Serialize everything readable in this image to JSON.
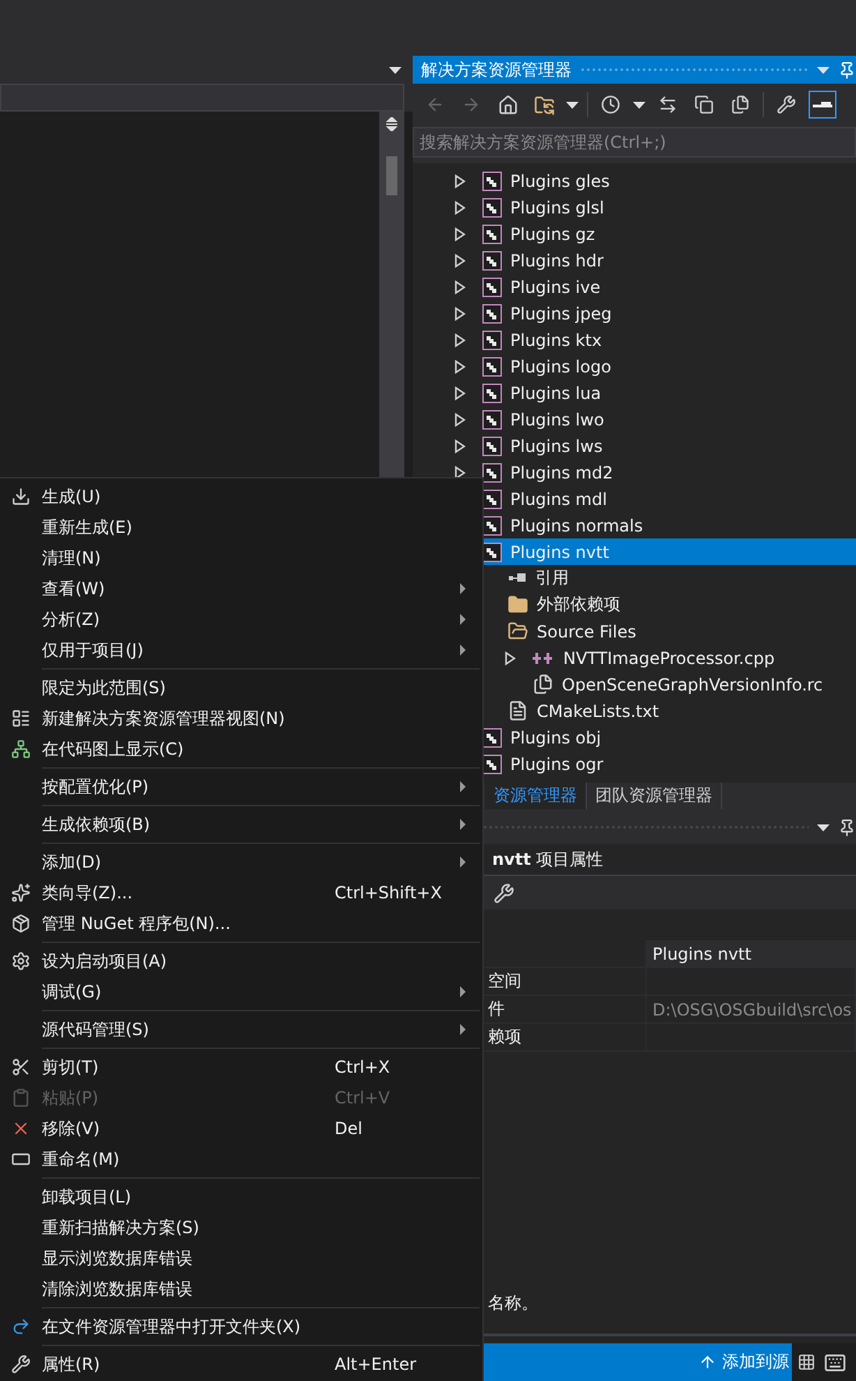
{
  "solution_explorer": {
    "title": "解决方案资源管理器",
    "search": {
      "placeholder": "搜索解决方案资源管理器(Ctrl+;)"
    },
    "tree": [
      {
        "kind": "project",
        "label": "Plugins gles",
        "expanded": false,
        "selected": false
      },
      {
        "kind": "project",
        "label": "Plugins glsl",
        "expanded": false,
        "selected": false
      },
      {
        "kind": "project",
        "label": "Plugins gz",
        "expanded": false,
        "selected": false
      },
      {
        "kind": "project",
        "label": "Plugins hdr",
        "expanded": false,
        "selected": false
      },
      {
        "kind": "project",
        "label": "Plugins ive",
        "expanded": false,
        "selected": false
      },
      {
        "kind": "project",
        "label": "Plugins jpeg",
        "expanded": false,
        "selected": false
      },
      {
        "kind": "project",
        "label": "Plugins ktx",
        "expanded": false,
        "selected": false
      },
      {
        "kind": "project",
        "label": "Plugins logo",
        "expanded": false,
        "selected": false
      },
      {
        "kind": "project",
        "label": "Plugins lua",
        "expanded": false,
        "selected": false
      },
      {
        "kind": "project",
        "label": "Plugins lwo",
        "expanded": false,
        "selected": false
      },
      {
        "kind": "project",
        "label": "Plugins lws",
        "expanded": false,
        "selected": false
      },
      {
        "kind": "project",
        "label": "Plugins md2",
        "expanded": false,
        "selected": false
      },
      {
        "kind": "project",
        "label": "Plugins mdl",
        "selected": false
      },
      {
        "kind": "project",
        "label": "Plugins normals",
        "selected": false
      },
      {
        "kind": "project",
        "label": "Plugins nvtt",
        "selected": true,
        "children": [
          {
            "kind": "references",
            "label": "引用",
            "selected": false
          },
          {
            "kind": "external",
            "label": "外部依赖项",
            "selected": false
          },
          {
            "kind": "folder",
            "label": "Source Files",
            "selected": false,
            "children": [
              {
                "kind": "cpp",
                "label": "NVTTImageProcessor.cpp",
                "expanded": false,
                "selected": false
              },
              {
                "kind": "file",
                "label": "OpenSceneGraphVersionInfo.rc",
                "selected": false
              }
            ]
          },
          {
            "kind": "text",
            "label": "CMakeLists.txt",
            "selected": false
          }
        ]
      },
      {
        "kind": "project",
        "label": "Plugins obj",
        "selected": false
      },
      {
        "kind": "project",
        "label": "Plugins ogr",
        "selected": false
      }
    ]
  },
  "tabs": [
    {
      "label": "资源管理器",
      "selected": true
    },
    {
      "label": "团队资源管理器",
      "selected": false
    }
  ],
  "properties": {
    "heading": "**nvtt** 项目属性",
    "header_value": "Plugins nvtt",
    "rows": [
      {
        "label": "空间"
      },
      {
        "label": "件",
        "value": "D:\\OSG\\OSGbuild\\src\\os"
      },
      {
        "label": "赖项"
      }
    ],
    "description": "名称。"
  },
  "status_bar": {
    "text": "添加到源"
  },
  "context_menu": {
    "groups": [
      [
        {
          "label": "生成(U)",
          "submenu": false,
          "disabled": false
        },
        {
          "label": "重新生成(E)",
          "submenu": false,
          "disabled": false
        },
        {
          "label": "清理(N)",
          "submenu": false,
          "disabled": false
        },
        {
          "label": "查看(W)",
          "submenu": true,
          "disabled": false
        },
        {
          "label": "分析(Z)",
          "submenu": true,
          "disabled": false
        },
        {
          "label": "仅用于项目(J)",
          "submenu": true,
          "disabled": false
        }
      ],
      [
        {
          "label": "限定为此范围(S)",
          "submenu": false,
          "disabled": false
        },
        {
          "label": "新建解决方案资源管理器视图(N)",
          "submenu": false,
          "disabled": false
        },
        {
          "label": "在代码图上显示(C)",
          "submenu": false,
          "disabled": false
        }
      ],
      [
        {
          "label": "按配置优化(P)",
          "submenu": true,
          "disabled": false
        }
      ],
      [
        {
          "label": "生成依赖项(B)",
          "submenu": true,
          "disabled": false
        }
      ],
      [
        {
          "label": "添加(D)",
          "submenu": true,
          "disabled": false
        },
        {
          "label": "类向导(Z)...",
          "shortcut": "Ctrl+Shift+X",
          "submenu": false,
          "disabled": false
        },
        {
          "label": "管理 NuGet 程序包(N)...",
          "submenu": false,
          "disabled": false
        }
      ],
      [
        {
          "label": "设为启动项目(A)",
          "submenu": false,
          "disabled": false
        },
        {
          "label": "调试(G)",
          "submenu": true,
          "disabled": false
        }
      ],
      [
        {
          "label": "源代码管理(S)",
          "submenu": true,
          "disabled": false
        }
      ],
      [
        {
          "label": "剪切(T)",
          "shortcut": "Ctrl+X",
          "submenu": false,
          "disabled": false
        },
        {
          "label": "粘贴(P)",
          "shortcut": "Ctrl+V",
          "submenu": false,
          "disabled": true
        },
        {
          "label": "移除(V)",
          "shortcut": "Del",
          "submenu": false,
          "disabled": false
        },
        {
          "label": "重命名(M)",
          "submenu": false,
          "disabled": false
        }
      ],
      [
        {
          "label": "卸载项目(L)",
          "submenu": false,
          "disabled": false
        },
        {
          "label": "重新扫描解决方案(S)",
          "submenu": false,
          "disabled": false
        },
        {
          "label": "显示浏览数据库错误",
          "submenu": false,
          "disabled": false
        },
        {
          "label": "清除浏览数据库错误",
          "submenu": false,
          "disabled": false
        }
      ],
      [
        {
          "label": "在文件资源管理器中打开文件夹(X)",
          "submenu": false,
          "disabled": false
        }
      ],
      [
        {
          "label": "属性(R)",
          "shortcut": "Alt+Enter",
          "submenu": false,
          "disabled": false
        }
      ]
    ]
  }
}
